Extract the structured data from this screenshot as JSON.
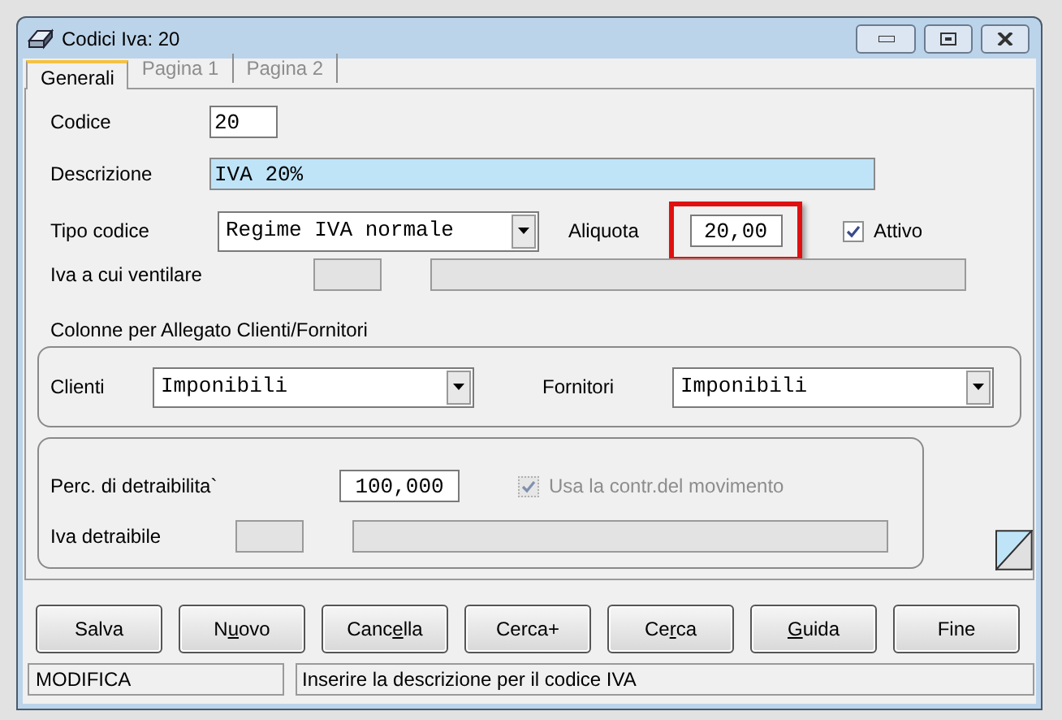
{
  "window": {
    "title": "Codici Iva: 20"
  },
  "tabs": [
    {
      "label": "Generali",
      "selected": true
    },
    {
      "label": "Pagina 1",
      "selected": false
    },
    {
      "label": "Pagina 2",
      "selected": false
    }
  ],
  "codice": {
    "label": "Codice",
    "value": "20"
  },
  "descrizione": {
    "label": "Descrizione",
    "value": "IVA 20%"
  },
  "tipo_codice": {
    "label": "Tipo codice",
    "value": "Regime IVA normale"
  },
  "aliquota": {
    "label": "Aliquota",
    "value": "20,00",
    "highlighted": true
  },
  "attivo": {
    "label": "Attivo",
    "checked": true,
    "disabled": false
  },
  "iva_ventilare": {
    "label": "Iva a cui ventilare"
  },
  "allegato": {
    "title": "Colonne per Allegato Clienti/Fornitori",
    "clienti": {
      "label": "Clienti",
      "value": "Imponibili"
    },
    "fornitori": {
      "label": "Fornitori",
      "value": "Imponibili"
    }
  },
  "perc": {
    "label": "Perc. di detraibilita`",
    "value": "100,000"
  },
  "usa_contr": {
    "label": "Usa la contr.del movimento",
    "checked": true,
    "disabled": true
  },
  "iva_detraibile": {
    "label": "Iva detraibile"
  },
  "buttons": [
    {
      "before": "Salva"
    },
    {
      "before": "N",
      "key": "u",
      "after": "ovo"
    },
    {
      "before": "Canc",
      "key": "e",
      "after": "lla"
    },
    {
      "before": "Cerca+"
    },
    {
      "before": "Ce",
      "key": "r",
      "after": "ca"
    },
    {
      "key": "G",
      "after": "uida"
    },
    {
      "before": "Fine"
    }
  ],
  "status_bar": {
    "mode": "MODIFICA",
    "message": "Inserire la descrizione per il codice IVA"
  }
}
